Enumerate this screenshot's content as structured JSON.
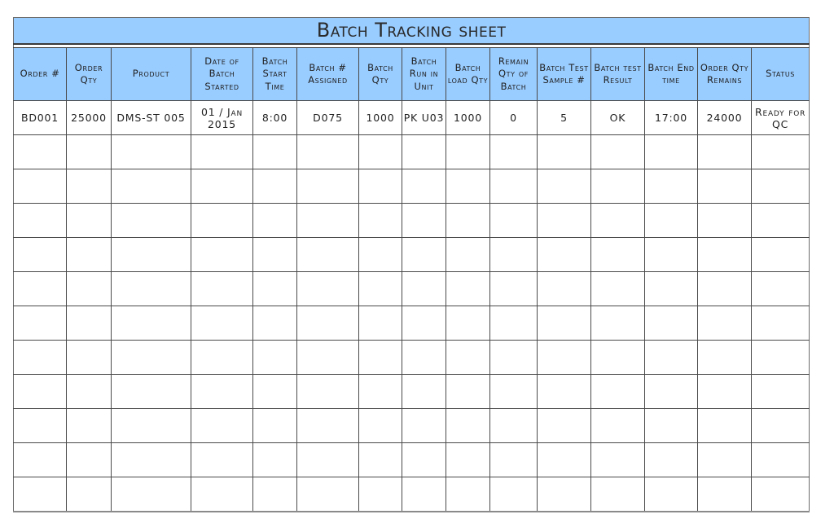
{
  "title": "Batch Tracking sheet",
  "columns": [
    "Order #",
    "Order Qty",
    "Product",
    "Date of Batch Started",
    "Batch Start Time",
    "Batch # Assigned",
    "Batch Qty",
    "Batch Run in Unit",
    "Batch load Qty",
    "Remain Qty of Batch",
    "Batch Test Sample #",
    "Batch test Result",
    "Batch End time",
    "Order Qty Remains",
    "Status"
  ],
  "rows": [
    [
      "BD001",
      "25000",
      "DMS-ST 005",
      "01 / Jan 2015",
      "8:00",
      "D075",
      "1000",
      "PK U03",
      "1000",
      "0",
      "5",
      "OK",
      "17:00",
      "24000",
      "Ready for QC"
    ],
    [
      "",
      "",
      "",
      "",
      "",
      "",
      "",
      "",
      "",
      "",
      "",
      "",
      "",
      "",
      ""
    ],
    [
      "",
      "",
      "",
      "",
      "",
      "",
      "",
      "",
      "",
      "",
      "",
      "",
      "",
      "",
      ""
    ],
    [
      "",
      "",
      "",
      "",
      "",
      "",
      "",
      "",
      "",
      "",
      "",
      "",
      "",
      "",
      ""
    ],
    [
      "",
      "",
      "",
      "",
      "",
      "",
      "",
      "",
      "",
      "",
      "",
      "",
      "",
      "",
      ""
    ],
    [
      "",
      "",
      "",
      "",
      "",
      "",
      "",
      "",
      "",
      "",
      "",
      "",
      "",
      "",
      ""
    ],
    [
      "",
      "",
      "",
      "",
      "",
      "",
      "",
      "",
      "",
      "",
      "",
      "",
      "",
      "",
      ""
    ],
    [
      "",
      "",
      "",
      "",
      "",
      "",
      "",
      "",
      "",
      "",
      "",
      "",
      "",
      "",
      ""
    ],
    [
      "",
      "",
      "",
      "",
      "",
      "",
      "",
      "",
      "",
      "",
      "",
      "",
      "",
      "",
      ""
    ],
    [
      "",
      "",
      "",
      "",
      "",
      "",
      "",
      "",
      "",
      "",
      "",
      "",
      "",
      "",
      ""
    ],
    [
      "",
      "",
      "",
      "",
      "",
      "",
      "",
      "",
      "",
      "",
      "",
      "",
      "",
      "",
      ""
    ],
    [
      "",
      "",
      "",
      "",
      "",
      "",
      "",
      "",
      "",
      "",
      "",
      "",
      "",
      "",
      ""
    ]
  ],
  "colors": {
    "header_bg": "#99ccff",
    "grid_line": "#4a4a4a"
  }
}
